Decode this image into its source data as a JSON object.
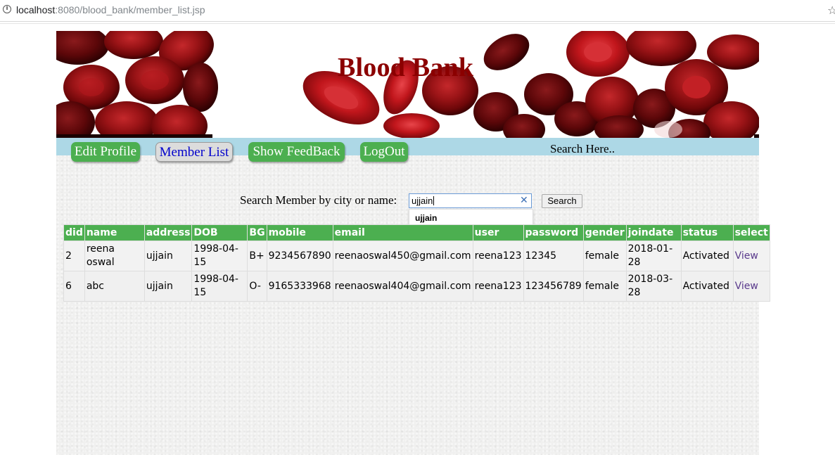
{
  "browser": {
    "url_host": "localhost",
    "url_rest": ":8080/blood_bank/member_list.jsp"
  },
  "header": {
    "title": "Blood Bank"
  },
  "nav": {
    "edit_profile": "Edit Profile",
    "member_list": "Member List",
    "show_feedback": "Show FeedBack",
    "logout": "LogOut",
    "search_here": "Search Here.."
  },
  "search": {
    "label": "Search Member by city or name:",
    "value": "ujjain",
    "suggestion": "ujjain",
    "button": "Search"
  },
  "table": {
    "headers": [
      "did",
      "name",
      "address",
      "DOB",
      "BG",
      "mobile",
      "email",
      "user",
      "password",
      "gender",
      "joindate",
      "status",
      "select"
    ],
    "rows": [
      {
        "did": "2",
        "name": "reena oswal",
        "address": "ujjain",
        "dob": "1998-04-15",
        "bg": "B+",
        "mobile": "9234567890",
        "email": "reenaoswal450@gmail.com",
        "user": "reena123",
        "password": "12345",
        "gender": "female",
        "joindate": "2018-01-28",
        "status": "Activated",
        "select": "View"
      },
      {
        "did": "6",
        "name": "abc",
        "address": "ujjain",
        "dob": "1998-04-15",
        "bg": "O-",
        "mobile": "9165333968",
        "email": "reenaoswal404@gmail.com",
        "user": "reena123",
        "password": "123456789",
        "gender": "female",
        "joindate": "2018-03-28",
        "status": "Activated",
        "select": "View"
      }
    ]
  },
  "colors": {
    "header_title": "#8b0000",
    "nav_bar": "#add8e6",
    "button_green": "#4caf50",
    "active_link": "#0000cc"
  }
}
